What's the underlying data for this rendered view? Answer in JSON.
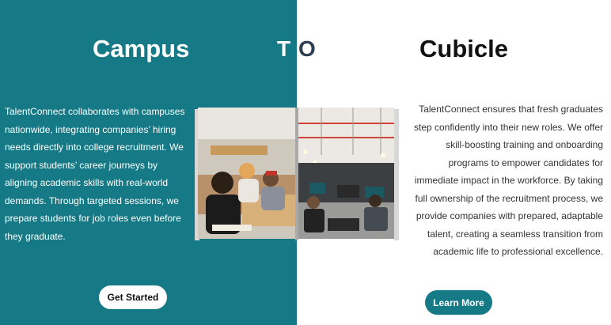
{
  "hero": {
    "title_left": "Campus",
    "title_mid_t": "T",
    "title_mid_o": "O",
    "title_right": "Cubicle"
  },
  "left": {
    "body": "TalentConnect collaborates with campuses nationwide, integrating companies’ hiring needs directly into college recruitment. We support students’ career journeys by aligning academic skills with real-world demands. Through targeted sessions, we prepare students for job roles even before they graduate.",
    "button_label": "Get Started"
  },
  "right": {
    "body": "TalentConnect ensures that fresh graduates step confidently into their new roles. We offer skill-boosting training and onboarding programs to empower candidates for immediate impact in the workforce. By taking full ownership of the recruitment process, we provide companies with prepared, adaptable talent, creating a seamless transition from academic life to professional excellence.",
    "button_label": "Learn More"
  },
  "colors": {
    "teal": "#157a85",
    "white": "#ffffff",
    "dark_text": "#111111",
    "body_text": "#333333"
  },
  "image": {
    "left_scene": "students-in-library-icon",
    "right_scene": "open-office-icon"
  }
}
